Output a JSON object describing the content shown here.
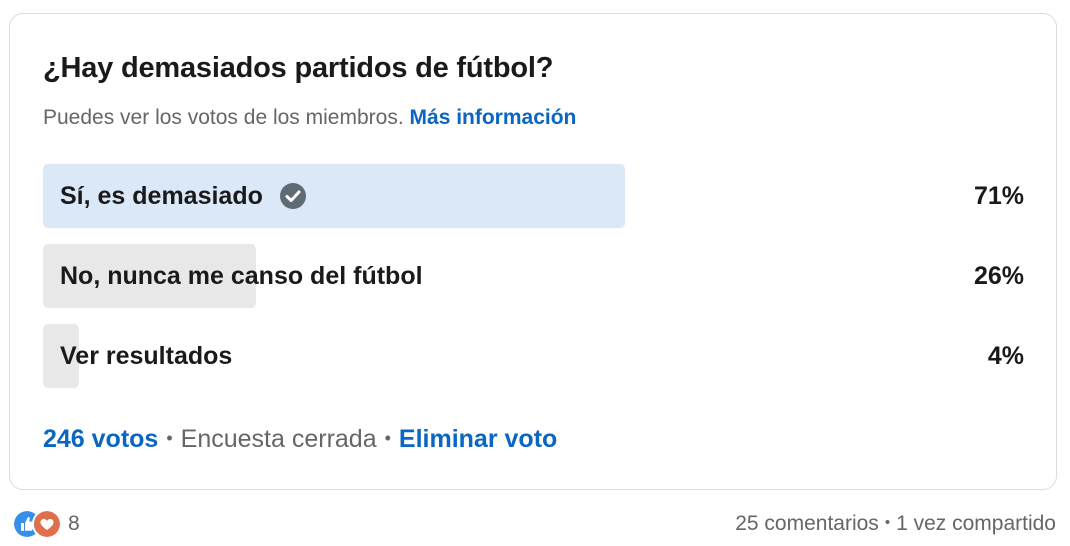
{
  "poll": {
    "question": "¿Hay demasiados partidos de fútbol?",
    "visibility_text": "Puedes ver los votos de los miembros.",
    "more_info_link": "Más información",
    "options": [
      {
        "label": "Sí, es demasiado",
        "percent_text": "71%",
        "percent": 71,
        "selected": true,
        "fill_color": "#dbe8f8"
      },
      {
        "label": "No, nunca me canso del fútbol",
        "percent_text": "26%",
        "percent": 26,
        "selected": false,
        "fill_color": "#e8e8e8"
      },
      {
        "label": "Ver resultados",
        "percent_text": "4%",
        "percent": 4,
        "selected": false,
        "fill_color": "#e8e8e8"
      }
    ],
    "votes_link": "246 votos",
    "status": "Encuesta cerrada",
    "remove_vote_link": "Eliminar voto",
    "separator": "•"
  },
  "social": {
    "reaction_icons": [
      "like-icon",
      "love-icon"
    ],
    "reaction_count": "8",
    "comments": "25 comentarios",
    "shares": "1 vez compartido",
    "separator": "•"
  },
  "colors": {
    "link": "#0a66c2",
    "selected_fill": "#dbe8f8",
    "unselected_fill": "#e8e8e8",
    "check_badge": "#5e6a74"
  }
}
